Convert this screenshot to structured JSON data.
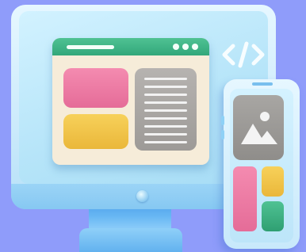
{
  "scene": {
    "background_color": "#8f9cfa",
    "accent_green": "#32a77a",
    "accent_pink": "#e56c98",
    "accent_yellow": "#eab73a",
    "icons": [
      "code-tag-icon",
      "image-icon",
      "power-button-icon"
    ]
  }
}
